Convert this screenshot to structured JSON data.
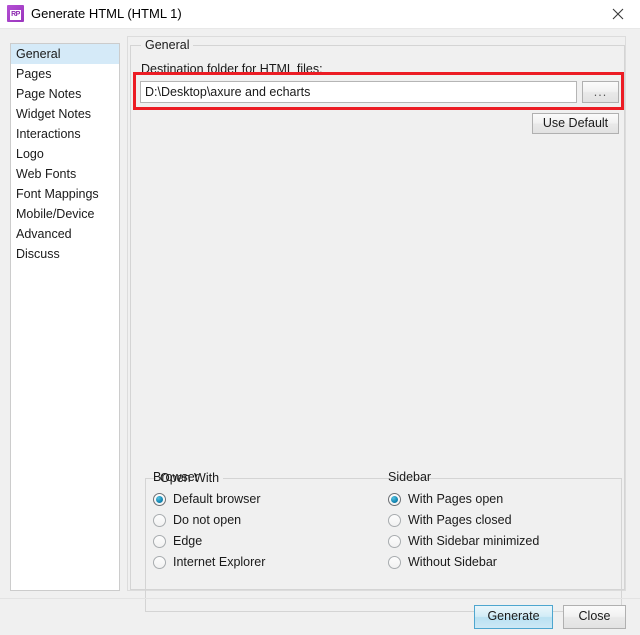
{
  "window": {
    "title": "Generate HTML (HTML 1)",
    "icon": "axure-rp-icon",
    "icon_glyph": "RP",
    "close_icon": "close-icon"
  },
  "sidebar": {
    "items": [
      {
        "label": "General",
        "selected": true
      },
      {
        "label": "Pages",
        "selected": false
      },
      {
        "label": "Page Notes",
        "selected": false
      },
      {
        "label": "Widget Notes",
        "selected": false
      },
      {
        "label": "Interactions",
        "selected": false
      },
      {
        "label": "Logo",
        "selected": false
      },
      {
        "label": "Web Fonts",
        "selected": false
      },
      {
        "label": "Font Mappings",
        "selected": false
      },
      {
        "label": "Mobile/Device",
        "selected": false
      },
      {
        "label": "Advanced",
        "selected": false
      },
      {
        "label": "Discuss",
        "selected": false
      }
    ]
  },
  "general": {
    "group_title": "General",
    "destination_label": "Destination folder for HTML files:",
    "destination_value": "D:\\Desktop\\axure and echarts",
    "destination_placeholder": "",
    "browse_label": "...",
    "use_default_label": "Use Default"
  },
  "open_with": {
    "group_title": "Open With",
    "browser": {
      "label": "Browser",
      "options": [
        {
          "label": "Default browser",
          "checked": true
        },
        {
          "label": "Do not open",
          "checked": false
        },
        {
          "label": "Edge",
          "checked": false
        },
        {
          "label": "Internet Explorer",
          "checked": false
        }
      ]
    },
    "sidebar": {
      "label": "Sidebar",
      "options": [
        {
          "label": "With Pages open",
          "checked": true
        },
        {
          "label": "With Pages closed",
          "checked": false
        },
        {
          "label": "With Sidebar minimized",
          "checked": false
        },
        {
          "label": "Without Sidebar",
          "checked": false
        }
      ]
    }
  },
  "footer": {
    "generate_label": "Generate",
    "close_label": "Close"
  },
  "annotation": {
    "highlight_color": "#ec1c24",
    "selection_color": "#d5eaf8",
    "radio_accent": "#1487b3"
  }
}
